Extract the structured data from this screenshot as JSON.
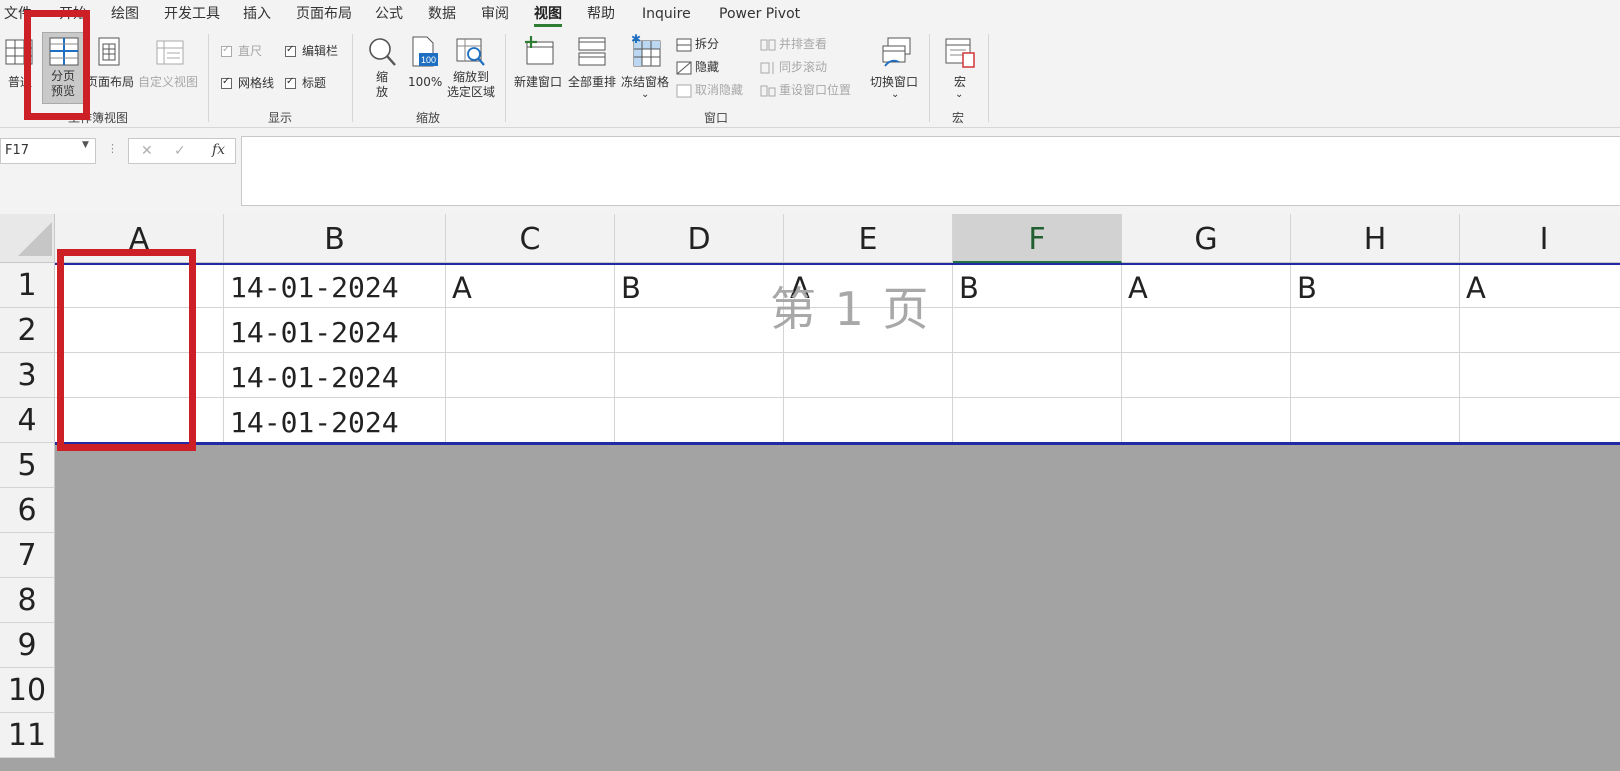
{
  "menu": {
    "items": [
      "文件",
      "开始",
      "绘图",
      "开发工具",
      "插入",
      "页面布局",
      "公式",
      "数据",
      "审阅",
      "视图",
      "帮助",
      "Inquire",
      "Power Pivot"
    ],
    "active": "视图"
  },
  "ribbon": {
    "workbook_views": {
      "normal": "普通",
      "page_break_line1": "分页",
      "page_break_line2": "预览",
      "page_layout": "页面布局",
      "custom_views": "自定义视图",
      "group_label": "工作簿视图"
    },
    "show": {
      "ruler": "直尺",
      "formula_bar": "编辑栏",
      "gridlines": "网格线",
      "headings": "标题",
      "group_label": "显示"
    },
    "zoom": {
      "zoom_line1": "缩",
      "zoom_line2": "放",
      "hundred": "100%",
      "hundred_icon_text": "100",
      "zoom_sel_line1": "缩放到",
      "zoom_sel_line2": "选定区域",
      "group_label": "缩放"
    },
    "window": {
      "new_window": "新建窗口",
      "arrange_all": "全部重排",
      "freeze_panes": "冻结窗格",
      "split": "拆分",
      "hide": "隐藏",
      "unhide": "取消隐藏",
      "side_by_side": "并排查看",
      "sync_scroll": "同步滚动",
      "reset_position": "重设窗口位置",
      "switch_windows": "切换窗口",
      "group_label": "窗口"
    },
    "macros": {
      "label": "宏",
      "group_label": "宏"
    }
  },
  "formula_bar": {
    "name_box": "F17",
    "dots": "⋮",
    "cancel": "✕",
    "enter": "✓",
    "fx": "fx",
    "value": ""
  },
  "grid": {
    "columns": [
      "A",
      "B",
      "C",
      "D",
      "E",
      "F",
      "G",
      "H",
      "I"
    ],
    "selected_column": "F",
    "rows": [
      "1",
      "2",
      "3",
      "4",
      "5",
      "6",
      "7",
      "8",
      "9",
      "10",
      "11"
    ],
    "cells": [
      [
        "",
        "14-01-2024",
        "A",
        "B",
        "A",
        "B",
        "A",
        "B",
        "A"
      ],
      [
        "",
        "14-01-2024",
        "",
        "",
        "",
        "",
        "",
        "",
        ""
      ],
      [
        "",
        "14-01-2024",
        "",
        "",
        "",
        "",
        "",
        "",
        ""
      ],
      [
        "",
        "14-01-2024",
        "",
        "",
        "",
        "",
        "",
        "",
        ""
      ]
    ],
    "page_watermark": "第 1 页"
  },
  "colors": {
    "highlight_box": "#cc1f26",
    "page_break": "#1f2aa3",
    "accent": "#217346"
  }
}
